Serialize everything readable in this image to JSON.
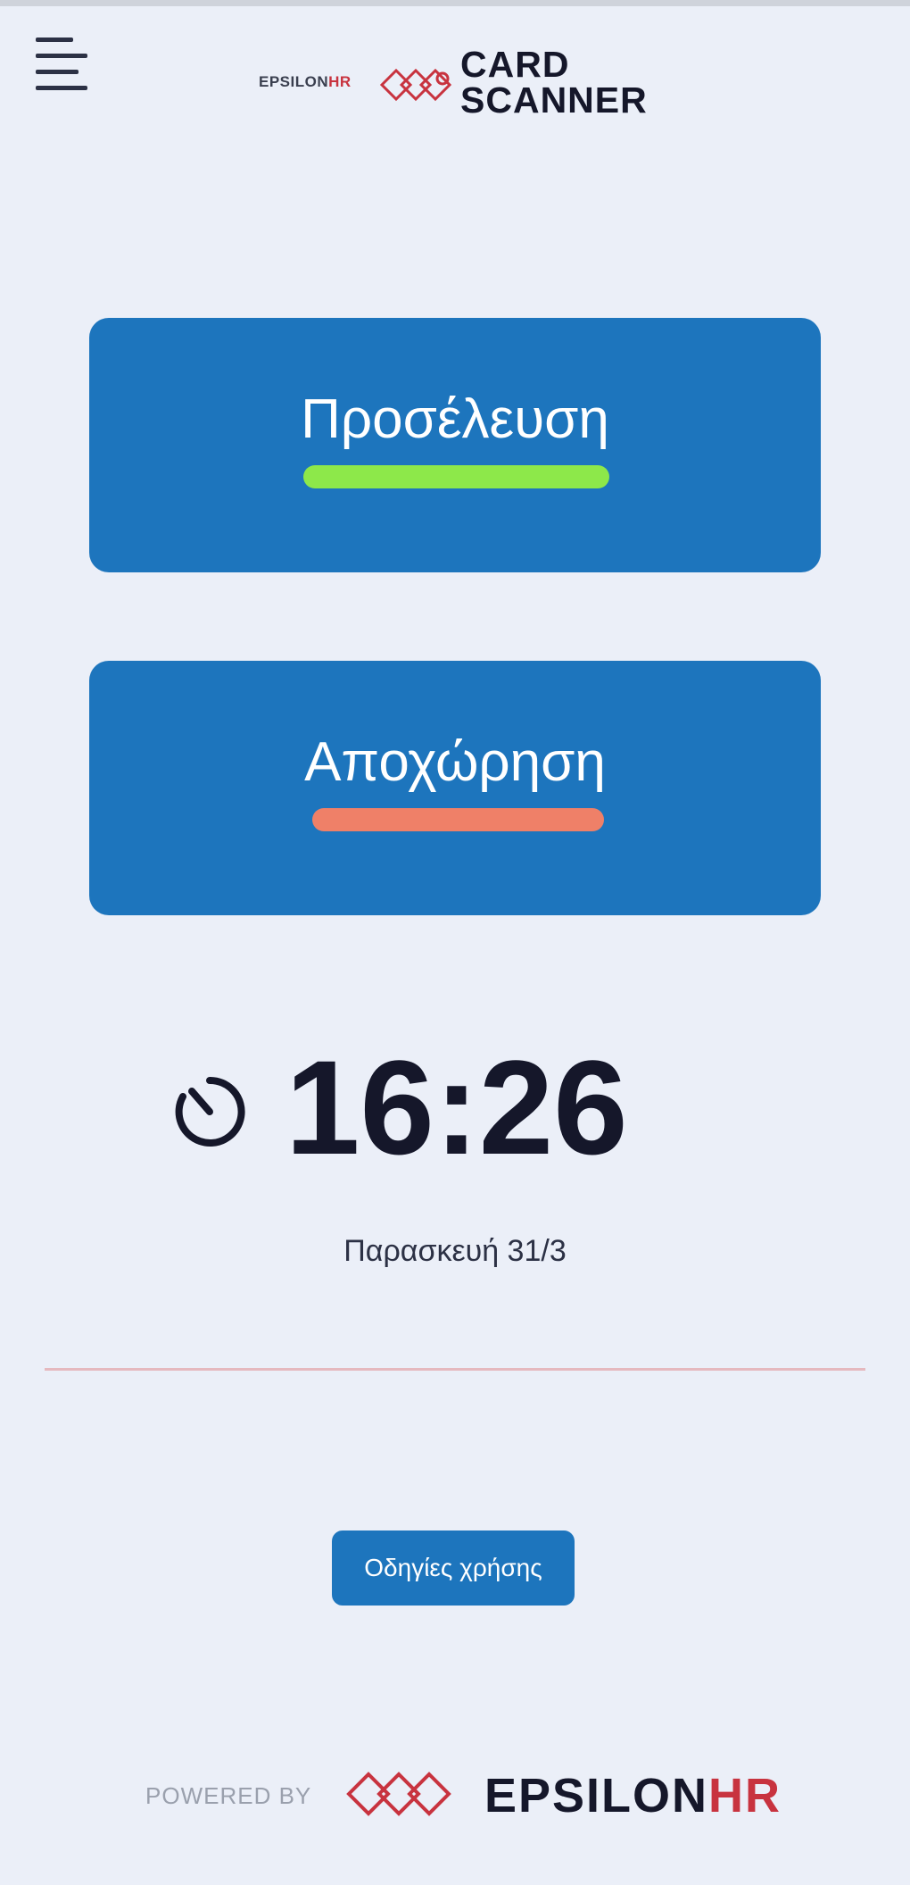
{
  "header": {
    "logo_small_main": "EPSILON",
    "logo_small_hr": "HR",
    "logo_title_line1": "CARD",
    "logo_title_line2": "SCANNER"
  },
  "actions": {
    "check_in_label": "Προσέλευση",
    "check_out_label": "Αποχώρηση"
  },
  "clock": {
    "time": "16:26",
    "date": "Παρασκευή 31/3"
  },
  "guide_button_label": "Οδηγίες χρήσης",
  "footer": {
    "powered_by": "POWERED BY",
    "brand_main": "EPSILON",
    "brand_hr": "HR"
  },
  "colors": {
    "background": "#ebeff8",
    "primary_button": "#1d75bd",
    "check_in_indicator": "#8de84a",
    "check_out_indicator": "#ef8068",
    "brand_red": "#c8333f",
    "text_dark": "#15172a"
  },
  "icons": {
    "menu": "hamburger-menu-icon",
    "clock": "timer-icon",
    "brand": "epsilon-logo-icon"
  }
}
